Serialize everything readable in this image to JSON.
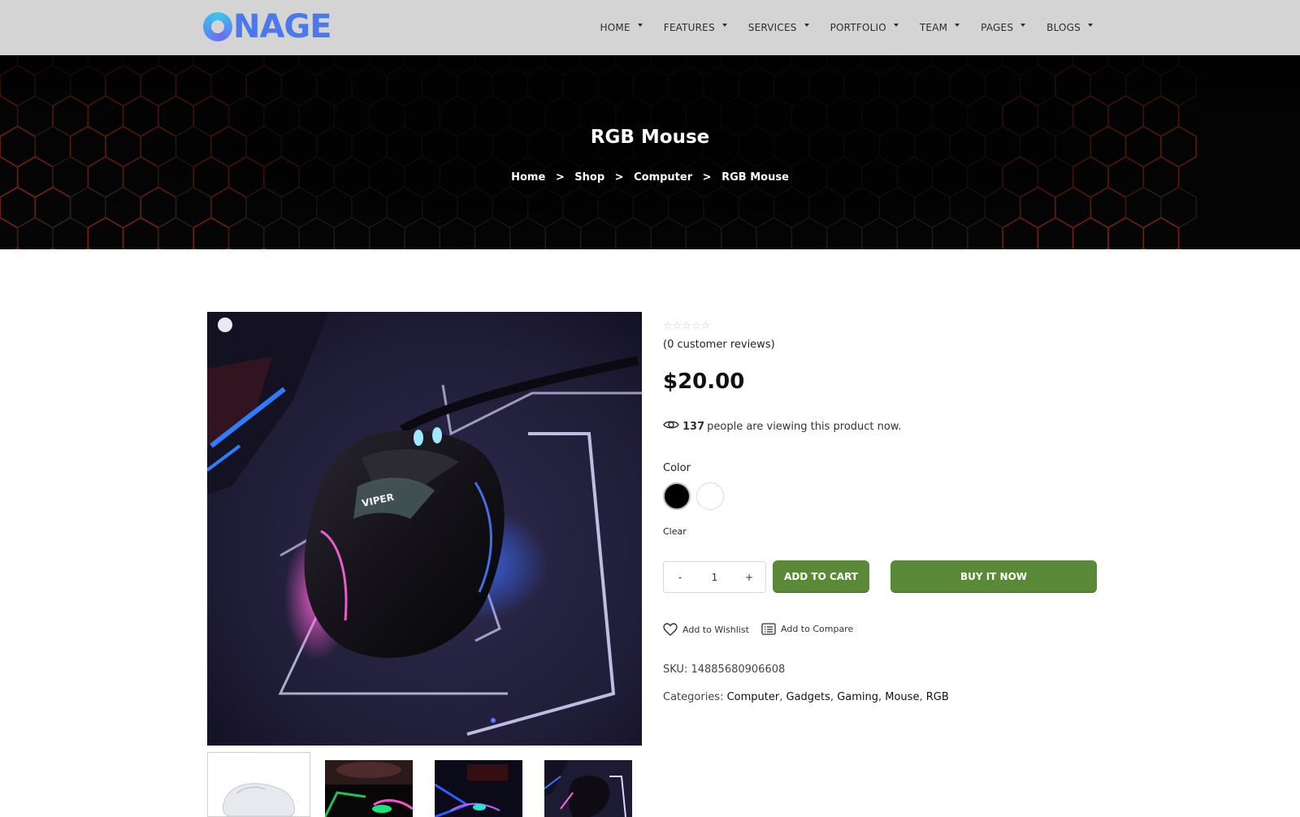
{
  "brand": {
    "logo_text": "NAGE",
    "logo_alt": "ONAGE",
    "accent": "#4b78ea"
  },
  "nav": {
    "items": [
      {
        "label": "HOME"
      },
      {
        "label": "FEATURES"
      },
      {
        "label": "SERVICES"
      },
      {
        "label": "PORTFOLIO"
      },
      {
        "label": "TEAM"
      },
      {
        "label": "PAGES"
      },
      {
        "label": "BLOGS"
      }
    ]
  },
  "banner": {
    "title": "RGB Mouse",
    "breadcrumb": [
      "Home",
      "Shop",
      "Computer",
      "RGB Mouse"
    ],
    "separator": ">"
  },
  "product": {
    "rating_stars": "☆☆☆☆☆",
    "rating_value": 0,
    "reviews_text": "(0 customer reviews)",
    "price": "$20.00",
    "viewing_count": "137",
    "viewing_text": "people are viewing this product now.",
    "color_label": "Color",
    "colors": [
      {
        "name": "black",
        "hex": "#000000",
        "selected": true
      },
      {
        "name": "white",
        "hex": "#ffffff",
        "selected": false
      }
    ],
    "clear_label": "Clear",
    "quantity": {
      "minus": "-",
      "value": "1",
      "plus": "+"
    },
    "add_to_cart_label": "ADD TO CART",
    "buy_now_label": "BUY IT NOW",
    "button_color": "#5a8a38",
    "wishlist_label": "Add to Wishlist",
    "compare_label": "Add to Compare",
    "sku_label": "SKU:",
    "sku_value": "14885680906608",
    "categories_label": "Categories:",
    "categories": [
      "Computer",
      "Gadgets",
      "Gaming",
      "Mouse",
      "RGB"
    ]
  },
  "gallery": {
    "main_image": "gaming-mouse-photo",
    "thumbnails": [
      "white-mouse-thumb",
      "rgb-keyboard-thumb",
      "rgb-desk-thumb",
      "gaming-mouse-thumb"
    ]
  }
}
